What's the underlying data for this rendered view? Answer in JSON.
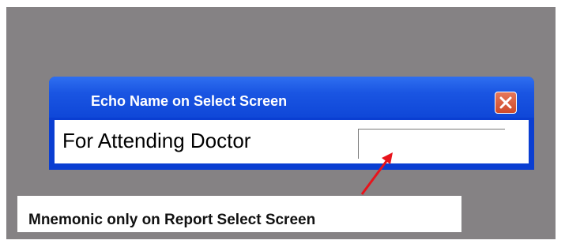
{
  "dialog": {
    "title": "Echo Name on Select Screen",
    "field_label": "For Attending Doctor",
    "field_value": "",
    "close_icon": "close-x-icon"
  },
  "callout": {
    "text": "Mnemonic only on Report Select Screen",
    "arrow_color": "#e8131b"
  },
  "colors": {
    "backdrop": "#858284",
    "titlebar": "#1a55e2",
    "frame": "#0a3ed2",
    "close_button": "#d9573a"
  }
}
